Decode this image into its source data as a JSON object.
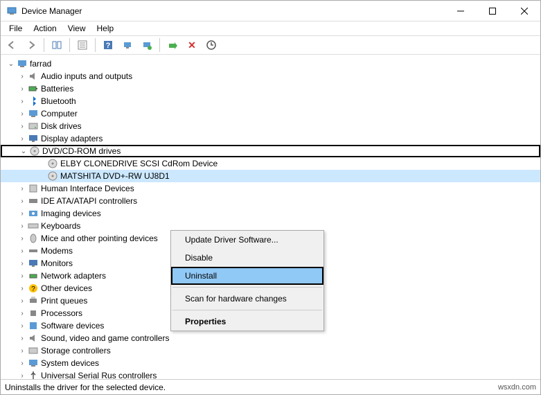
{
  "window": {
    "title": "Device Manager"
  },
  "menu": {
    "items": [
      "File",
      "Action",
      "View",
      "Help"
    ]
  },
  "toolbar": {
    "back": "←",
    "forward": "→",
    "properties": "▥",
    "help": "?",
    "uninstall_x": "✕"
  },
  "tree": {
    "root": "farrad",
    "nodes": [
      {
        "label": "Audio inputs and outputs",
        "icon": "audio",
        "expanded": false
      },
      {
        "label": "Batteries",
        "icon": "battery",
        "expanded": false
      },
      {
        "label": "Bluetooth",
        "icon": "bluetooth",
        "expanded": false
      },
      {
        "label": "Computer",
        "icon": "computer",
        "expanded": false
      },
      {
        "label": "Disk drives",
        "icon": "disk",
        "expanded": false
      },
      {
        "label": "Display adapters",
        "icon": "display",
        "expanded": false
      },
      {
        "label": "DVD/CD-ROM drives",
        "icon": "dvd",
        "expanded": true,
        "highlight": true,
        "children": [
          {
            "label": "ELBY CLONEDRIVE SCSI CdRom Device",
            "icon": "dvd"
          },
          {
            "label": "MATSHITA DVD+-RW UJ8D1",
            "icon": "dvd",
            "selected": true
          }
        ]
      },
      {
        "label": "Human Interface Devices",
        "icon": "hid",
        "expanded": false
      },
      {
        "label": "IDE ATA/ATAPI controllers",
        "icon": "ide",
        "expanded": false
      },
      {
        "label": "Imaging devices",
        "icon": "imaging",
        "expanded": false
      },
      {
        "label": "Keyboards",
        "icon": "keyboard",
        "expanded": false
      },
      {
        "label": "Mice and other pointing devices",
        "icon": "mouse",
        "expanded": false
      },
      {
        "label": "Modems",
        "icon": "modem",
        "expanded": false
      },
      {
        "label": "Monitors",
        "icon": "monitor",
        "expanded": false
      },
      {
        "label": "Network adapters",
        "icon": "network",
        "expanded": false
      },
      {
        "label": "Other devices",
        "icon": "other",
        "expanded": false
      },
      {
        "label": "Print queues",
        "icon": "printer",
        "expanded": false
      },
      {
        "label": "Processors",
        "icon": "cpu",
        "expanded": false
      },
      {
        "label": "Software devices",
        "icon": "software",
        "expanded": false
      },
      {
        "label": "Sound, video and game controllers",
        "icon": "sound",
        "expanded": false
      },
      {
        "label": "Storage controllers",
        "icon": "storage",
        "expanded": false
      },
      {
        "label": "System devices",
        "icon": "system",
        "expanded": false
      },
      {
        "label": "Universal Serial Rus controllers",
        "icon": "usb",
        "expanded": false
      }
    ]
  },
  "context_menu": {
    "items": [
      {
        "label": "Update Driver Software...",
        "type": "item"
      },
      {
        "label": "Disable",
        "type": "item"
      },
      {
        "label": "Uninstall",
        "type": "item",
        "highlighted": true
      },
      {
        "type": "separator"
      },
      {
        "label": "Scan for hardware changes",
        "type": "item"
      },
      {
        "type": "separator"
      },
      {
        "label": "Properties",
        "type": "item",
        "bold": true
      }
    ]
  },
  "statusbar": {
    "text": "Uninstalls the driver for the selected device.",
    "watermark": "wsxdn.com"
  }
}
